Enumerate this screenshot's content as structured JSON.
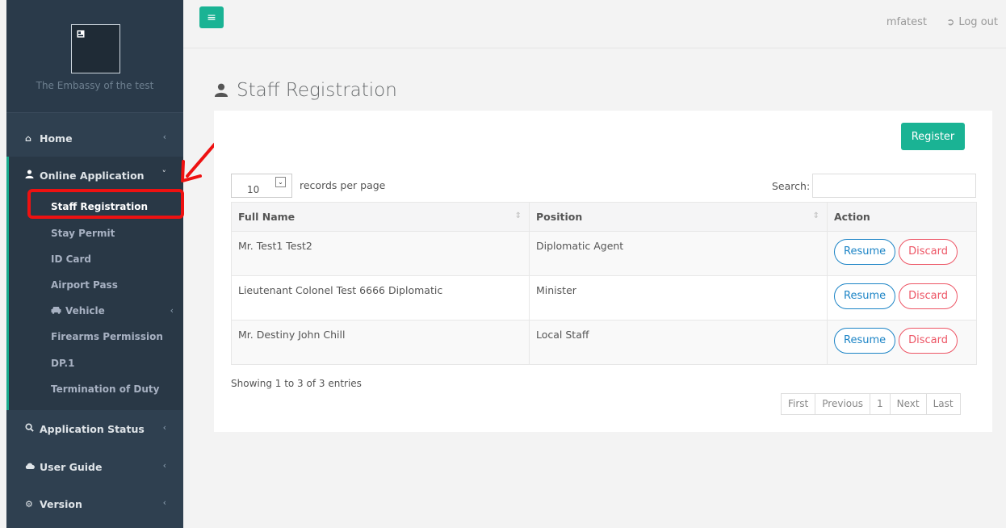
{
  "sidebar": {
    "brand_name": "The Embassy of the test",
    "home": "Home",
    "online_application": "Online Application",
    "sub_items": [
      "Staff Registration",
      "Stay Permit",
      "ID Card",
      "Airport Pass",
      "Vehicle",
      "Firearms Permission",
      "DP.1",
      "Termination of Duty"
    ],
    "application_status": "Application Status",
    "user_guide": "User Guide",
    "version": "Version"
  },
  "topbar": {
    "username": "mfatest",
    "logout": "Log out"
  },
  "page": {
    "title": "Staff Registration",
    "register_button": "Register",
    "length_value": "10",
    "length_label": "records per page",
    "search_label": "Search:",
    "search_value": ""
  },
  "table": {
    "columns": [
      "Full Name",
      "Position",
      "Action"
    ],
    "rows": [
      {
        "full_name": "Mr. Test1 Test2",
        "position": "Diplomatic Agent",
        "resume": "Resume",
        "discard": "Discard"
      },
      {
        "full_name": "Lieutenant Colonel Test 6666 Diplomatic",
        "position": "Minister",
        "resume": "Resume",
        "discard": "Discard"
      },
      {
        "full_name": "Mr. Destiny John Chill",
        "position": "Local Staff",
        "resume": "Resume",
        "discard": "Discard"
      }
    ]
  },
  "footer": {
    "info": "Showing 1 to 3 of 3 entries",
    "pagination": [
      "First",
      "Previous",
      "1",
      "Next",
      "Last"
    ]
  },
  "colors": {
    "sidebar_bg": "#2f4050",
    "accent": "#1ab394",
    "resume": "#1c84c6",
    "discard": "#ed5565",
    "annotation": "#ee1111"
  }
}
